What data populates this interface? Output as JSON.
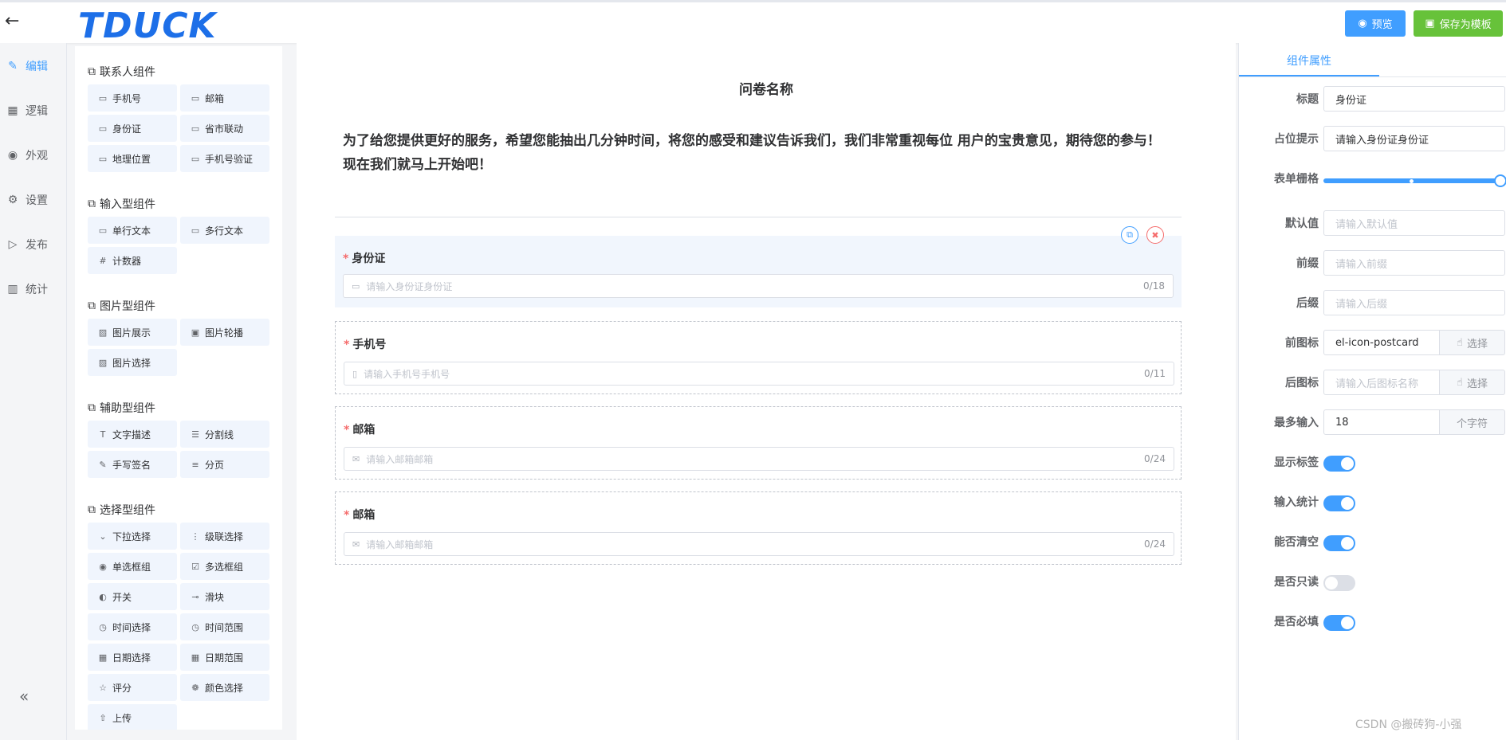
{
  "header": {
    "logo": "TDUCK",
    "preview_label": "预览",
    "save_template_label": "保存为模板"
  },
  "nav": [
    {
      "label": "编辑",
      "icon": "edit-icon",
      "glyph": "✎"
    },
    {
      "label": "逻辑",
      "icon": "grid-icon",
      "glyph": "▦"
    },
    {
      "label": "外观",
      "icon": "eye-icon",
      "glyph": "◉"
    },
    {
      "label": "设置",
      "icon": "gear-icon",
      "glyph": "⚙"
    },
    {
      "label": "发布",
      "icon": "play-icon",
      "glyph": "▷"
    },
    {
      "label": "统计",
      "icon": "chart-icon",
      "glyph": "▥"
    }
  ],
  "palette": {
    "contact": {
      "title": "联系人组件",
      "items": [
        "手机号",
        "邮箱",
        "身份证",
        "省市联动",
        "地理位置",
        "手机号验证"
      ]
    },
    "input": {
      "title": "输入型组件",
      "items": [
        "单行文本",
        "多行文本",
        "计数器"
      ]
    },
    "image": {
      "title": "图片型组件",
      "items": [
        "图片展示",
        "图片轮播",
        "图片选择"
      ]
    },
    "aux": {
      "title": "辅助型组件",
      "items": [
        "文字描述",
        "分割线",
        "手写签名",
        "分页"
      ]
    },
    "choice": {
      "title": "选择型组件",
      "items": [
        "下拉选择",
        "级联选择",
        "单选框组",
        "多选框组",
        "开关",
        "滑块",
        "时间选择",
        "时间范围",
        "日期选择",
        "日期范围",
        "评分",
        "颜色选择",
        "上传"
      ]
    }
  },
  "form": {
    "title": "问卷名称",
    "description": "为了给您提供更好的服务，希望您能抽出几分钟时间，将您的感受和建议告诉我们，我们非常重视每位 用户的宝贵意见，期待您的参与！现在我们就马上开始吧！",
    "fields": [
      {
        "label": "身份证",
        "placeholder": "请输入身份证身份证",
        "count": "0/18"
      },
      {
        "label": "手机号",
        "placeholder": "请输入手机号手机号",
        "count": "0/11"
      },
      {
        "label": "邮箱",
        "placeholder": "请输入邮箱邮箱",
        "count": "0/24"
      },
      {
        "label": "邮箱",
        "placeholder": "请输入邮箱邮箱",
        "count": "0/24"
      }
    ],
    "required_mark": "*"
  },
  "props": {
    "tab": "组件属性",
    "title_label": "标题",
    "title_value": "身份证",
    "placeholder_label": "占位提示",
    "placeholder_value": "请输入身份证身份证",
    "grid_label": "表单栅格",
    "default_label": "默认值",
    "default_ph": "请输入默认值",
    "prefix_label": "前缀",
    "prefix_ph": "请输入前缀",
    "suffix_label": "后缀",
    "suffix_ph": "请输入后缀",
    "prefix_icon_label": "前图标",
    "prefix_icon_value": "el-icon-postcard",
    "suffix_icon_label": "后图标",
    "suffix_icon_ph": "请输入后图标名称",
    "choose_label": "选择",
    "maxlen_label": "最多输入",
    "maxlen_value": "18",
    "maxlen_unit": "个字符",
    "show_label_label": "显示标签",
    "word_limit_label": "输入统计",
    "clearable_label": "能否清空",
    "readonly_label": "是否只读",
    "required_label": "是否必填",
    "grid_span": 24,
    "grid_max": 24,
    "switches": {
      "show_label": true,
      "word_limit": true,
      "clearable": true,
      "readonly": false,
      "required": true
    }
  },
  "watermark": "CSDN @搬砖狗-小强",
  "colors": {
    "accent": "#409eff",
    "success": "#67c23a",
    "danger": "#f56c6c"
  }
}
